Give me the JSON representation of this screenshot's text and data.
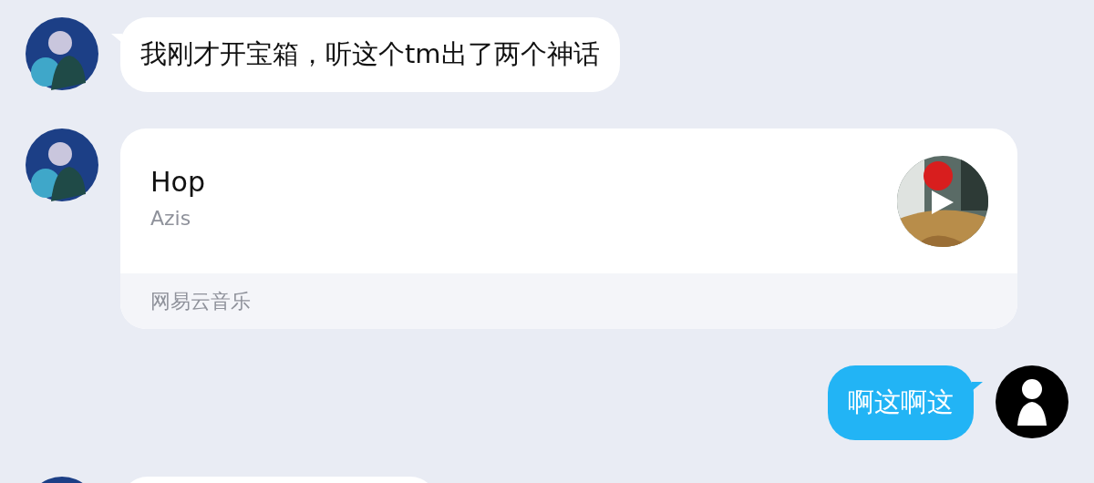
{
  "messages": [
    {
      "kind": "text",
      "outgoing": false,
      "text": "我刚才开宝箱，听这个tm出了两个神话"
    },
    {
      "kind": "music",
      "outgoing": false,
      "title": "Hop",
      "artist": "Azis",
      "source": "网易云音乐"
    },
    {
      "kind": "text",
      "outgoing": true,
      "text": "啊这啊这"
    },
    {
      "kind": "text",
      "outgoing": false
    }
  ]
}
